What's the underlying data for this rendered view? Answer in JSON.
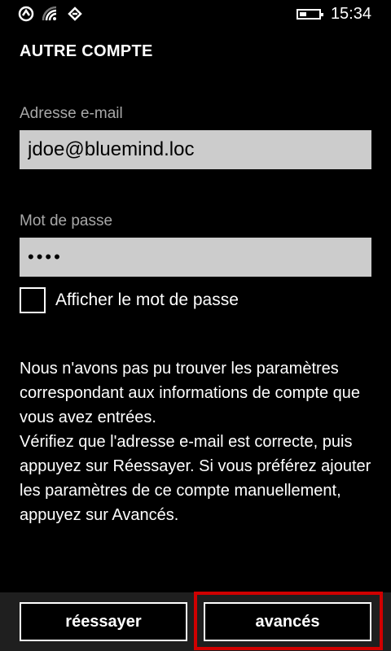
{
  "status_bar": {
    "icons": [
      "sync-icon",
      "wifi-icon",
      "data-connection-icon"
    ],
    "battery_level": 0.35,
    "time": "15:34"
  },
  "page": {
    "title": "AUTRE COMPTE"
  },
  "form": {
    "email": {
      "label": "Adresse e-mail",
      "value": "jdoe@bluemind.loc"
    },
    "password": {
      "label": "Mot de passe",
      "masked_value": "••••"
    },
    "show_password": {
      "label": "Afficher le mot de passe",
      "checked": false
    }
  },
  "message": {
    "paragraph1": "Nous n'avons pas pu trouver les paramètres correspondant aux informations de compte que vous avez entrées.",
    "paragraph2": "Vérifiez que l'adresse e-mail est correcte, puis appuyez sur Réessayer. Si vous préférez ajouter les paramètres de ce compte manuellement, appuyez sur Avancés."
  },
  "app_bar": {
    "retry_label": "réessayer",
    "advanced_label": "avancés",
    "highlight_color": "#d00000"
  }
}
